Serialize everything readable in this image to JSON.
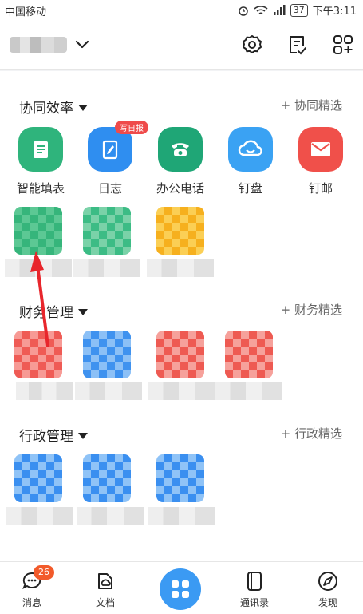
{
  "status_bar": {
    "carrier": "中国移动",
    "battery": "37",
    "time": "下午3:11"
  },
  "sections": {
    "collab": {
      "title": "协同效率",
      "link": "+ 协同精选"
    },
    "finance": {
      "title": "财务管理",
      "link": "+ 财务精选"
    },
    "admin": {
      "title": "行政管理",
      "link": "+ 行政精选"
    }
  },
  "apps": {
    "smart_form": "智能填表",
    "log": "日志",
    "log_badge": "写日报",
    "office_phone": "办公电话",
    "ding_pan": "钉盘",
    "ding_mail": "钉邮"
  },
  "bottom_nav": {
    "messages": "消息",
    "messages_badge": "26",
    "docs": "文档",
    "contacts": "通讯录",
    "discover": "发现"
  },
  "colors": {
    "green": "#2fb47c",
    "blue": "#2f8ef0",
    "teal": "#1fa676",
    "sky": "#3aa2f3",
    "red": "#f0504a",
    "accent": "#3b9af3"
  },
  "icons": [
    "settings-icon",
    "edit-list-icon",
    "add-apps-icon",
    "chevron-down-icon",
    "message-icon",
    "docs-icon",
    "grid-icon",
    "contacts-icon",
    "compass-icon"
  ]
}
